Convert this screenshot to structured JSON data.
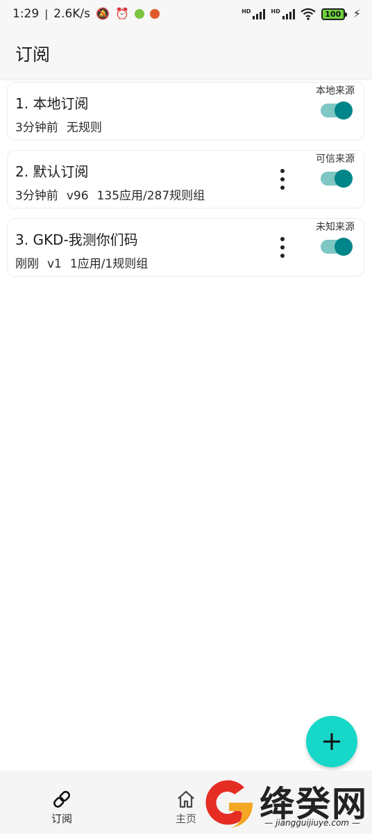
{
  "status_bar": {
    "time": "1:29",
    "speed": "2.6K/s",
    "battery": "100"
  },
  "app_bar": {
    "title": "订阅"
  },
  "subscriptions": [
    {
      "title": "1. 本地订阅",
      "meta": [
        "3分钟前",
        "无规则"
      ],
      "source": "本地来源",
      "has_menu": false,
      "enabled": true
    },
    {
      "title": "2. 默认订阅",
      "meta": [
        "3分钟前",
        "v96",
        "135应用/287规则组"
      ],
      "source": "可信来源",
      "has_menu": true,
      "enabled": true
    },
    {
      "title": "3. GKD-我测你们码",
      "meta": [
        "刚刚",
        "v1",
        "1应用/1规则组"
      ],
      "source": "未知来源",
      "has_menu": true,
      "enabled": true
    }
  ],
  "fab": {
    "icon": "plus-icon"
  },
  "bottom_nav": {
    "items": [
      {
        "label": "订阅",
        "icon": "link-icon",
        "active": true
      },
      {
        "label": "主页",
        "icon": "home-icon",
        "active": false
      }
    ]
  },
  "watermark": {
    "text": "绛癸网",
    "url": "jiangguijiuye.com"
  },
  "colors": {
    "accent": "#00858a",
    "toggle_track": "#7fc7c5",
    "fab": "#17d8c8"
  }
}
